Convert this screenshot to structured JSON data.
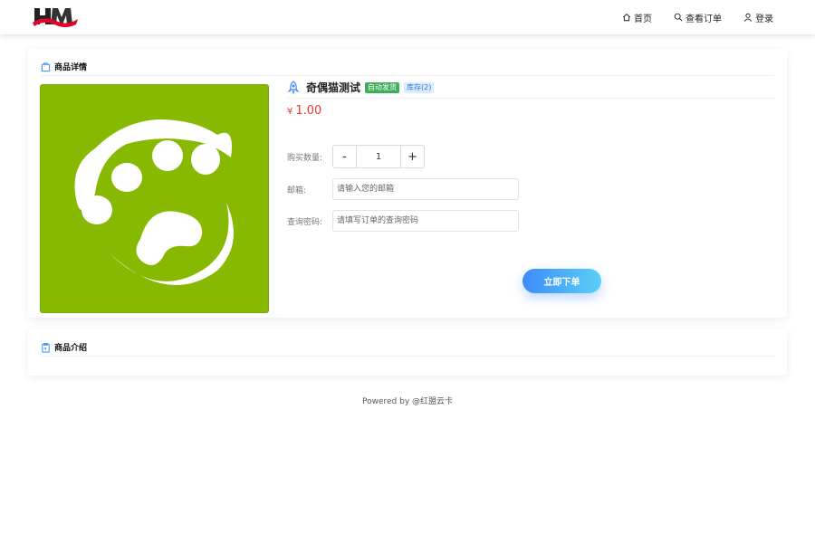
{
  "header": {
    "logo_name": "logo",
    "nav": [
      {
        "label": "首页",
        "icon": "home-icon"
      },
      {
        "label": "查看订单",
        "icon": "search-icon"
      },
      {
        "label": "登录",
        "icon": "user-icon"
      }
    ]
  },
  "detail": {
    "section_title": "商品详情",
    "product_name": "奇偶猫测试",
    "badge_auto": "自动发货",
    "badge_stock": "库存(2)",
    "currency": "¥",
    "price": "1.00",
    "quantity_label": "购买数量:",
    "quantity_minus": "-",
    "quantity_value": "1",
    "quantity_plus": "+",
    "email_label": "邮箱:",
    "email_placeholder": "请输入您的邮箱",
    "password_label": "查询密码:",
    "password_placeholder": "请填写订单的查询密码",
    "submit_label": "立即下单",
    "image_color": "#86b900"
  },
  "intro": {
    "section_title": "商品介绍"
  },
  "footer": {
    "text": "Powered by @红盟云卡"
  },
  "colors": {
    "accent": "#3d8bfa",
    "price": "#e4393c",
    "badge_auto": "#3dae5a"
  }
}
